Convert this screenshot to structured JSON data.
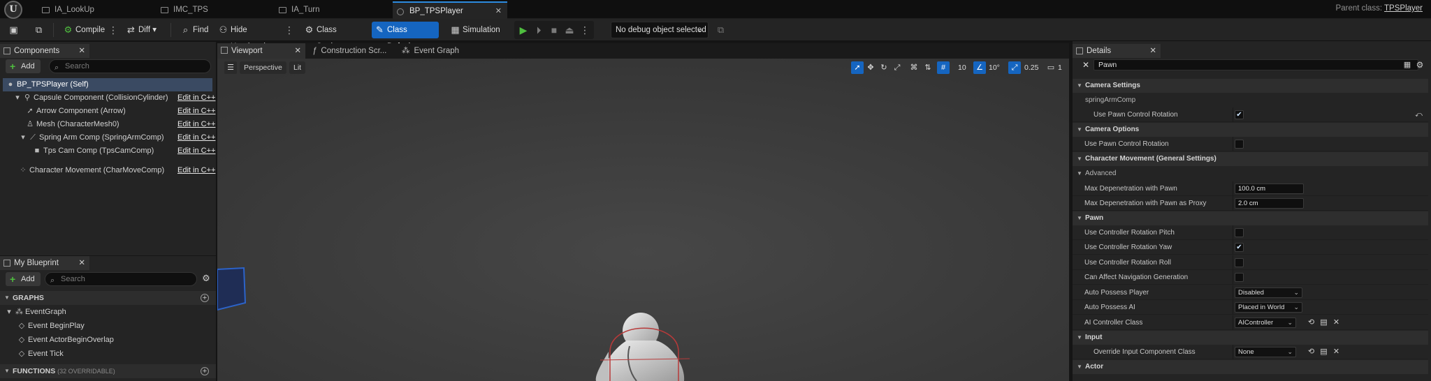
{
  "tabs": [
    {
      "label": "IA_LookUp"
    },
    {
      "label": "IMC_TPS"
    },
    {
      "label": "IA_Turn"
    },
    {
      "label": "BP_TPSPlayer"
    }
  ],
  "parent_class": {
    "label": "Parent class:",
    "value": "TPSPlayer"
  },
  "toolbar": {
    "compile": "Compile",
    "diff": "Diff",
    "find": "Find",
    "hide_unrelated": "Hide Unrelated",
    "class_settings": "Class Settings",
    "class_defaults": "Class Defaults",
    "simulation": "Simulation",
    "debug_object": "No debug object selected"
  },
  "components": {
    "title": "Components",
    "add": "Add",
    "search_placeholder": "Search",
    "edit_label": "Edit in C++",
    "root": "BP_TPSPlayer (Self)",
    "items": [
      {
        "label": "Capsule Component (CollisionCylinder)"
      },
      {
        "label": "Arrow Component (Arrow)"
      },
      {
        "label": "Mesh (CharacterMesh0)"
      },
      {
        "label": "Spring Arm Comp (SpringArmComp)"
      },
      {
        "label": "Tps Cam Comp (TpsCamComp)"
      },
      {
        "label": "Character Movement (CharMoveComp)"
      }
    ]
  },
  "my_blueprint": {
    "title": "My Blueprint",
    "add": "Add",
    "search_placeholder": "Search",
    "graphs_header": "GRAPHS",
    "event_graph": "EventGraph",
    "events": [
      "Event BeginPlay",
      "Event ActorBeginOverlap",
      "Event Tick"
    ],
    "functions_header": "FUNCTIONS",
    "functions_count": "(32 OVERRIDABLE)"
  },
  "center_tabs": {
    "viewport": "Viewport",
    "construction": "Construction Scr...",
    "event_graph": "Event Graph"
  },
  "viewport": {
    "perspective": "Perspective",
    "lit": "Lit",
    "grid_snap": "10",
    "rot_snap": "10°",
    "scale_snap": "0.25",
    "camera_speed": "1"
  },
  "details": {
    "title": "Details",
    "search_value": "Pawn",
    "camera_settings": "Camera Settings",
    "spring_arm_comp": "springArmComp",
    "use_pawn_control_rotation": "Use Pawn Control Rotation",
    "camera_options": "Camera Options",
    "char_movement": "Character Movement (General Settings)",
    "advanced": "Advanced",
    "max_depen_pawn": "Max Depenetration with Pawn",
    "max_depen_pawn_value": "100.0 cm",
    "max_depen_proxy": "Max Depenetration with Pawn as Proxy",
    "max_depen_proxy_value": "2.0 cm",
    "pawn": "Pawn",
    "use_ctrl_pitch": "Use Controller Rotation Pitch",
    "use_ctrl_yaw": "Use Controller Rotation Yaw",
    "use_ctrl_roll": "Use Controller Rotation Roll",
    "can_affect_nav": "Can Affect Navigation Generation",
    "auto_possess_player": "Auto Possess Player",
    "auto_possess_player_value": "Disabled",
    "auto_possess_ai": "Auto Possess AI",
    "auto_possess_ai_value": "Placed in World",
    "ai_controller_class": "AI Controller Class",
    "ai_controller_class_value": "AIController",
    "input": "Input",
    "override_input": "Override Input Component Class",
    "override_input_value": "None",
    "actor": "Actor"
  }
}
